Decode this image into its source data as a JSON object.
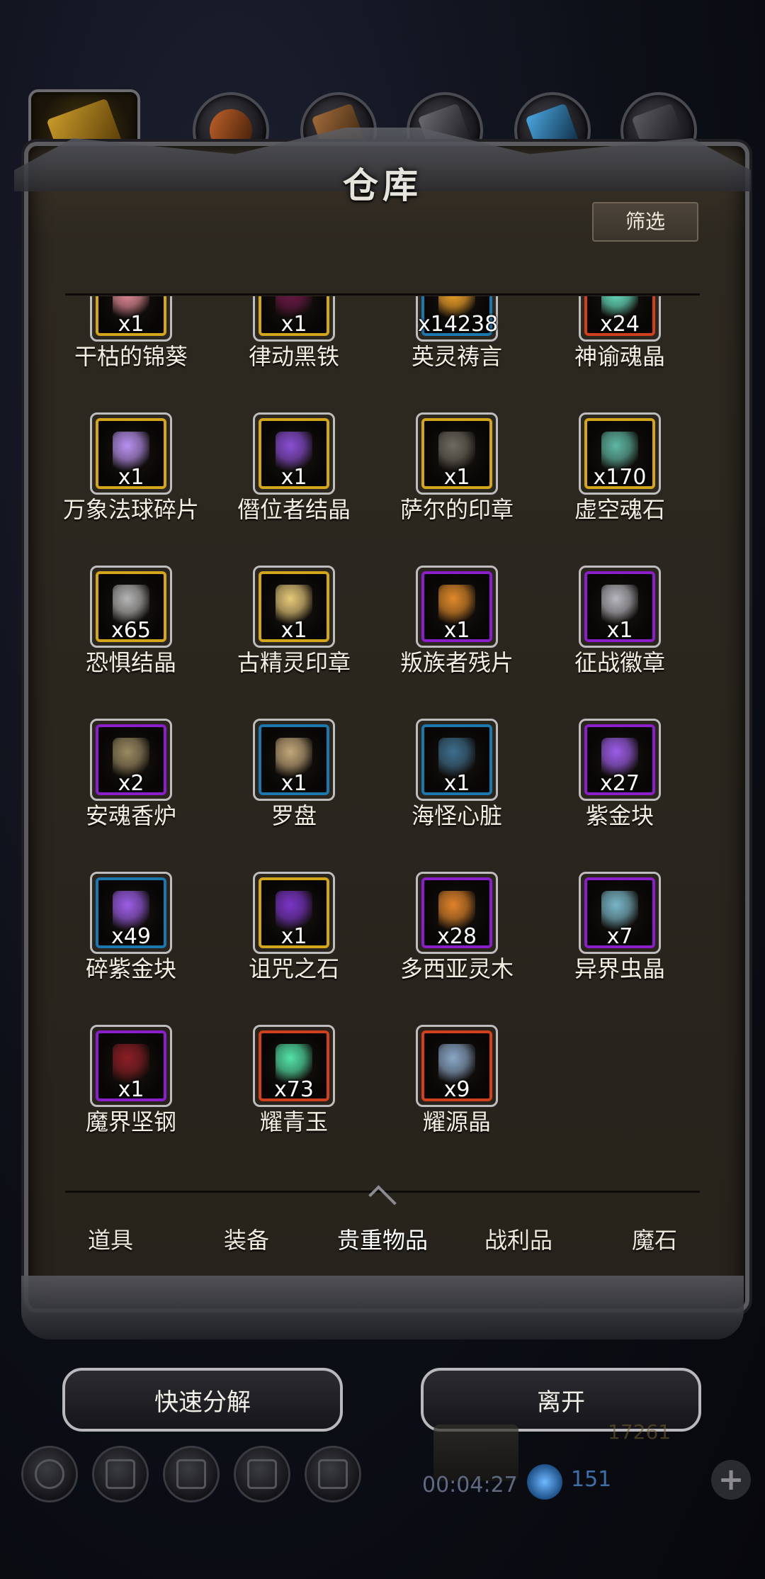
{
  "window": {
    "title": "仓库"
  },
  "filter_label": "筛选",
  "rarity_colors": {
    "legendary": "#d3a51a",
    "epic": "#8a1fc9",
    "rare": "#1b77ad",
    "mythic": "#d0401c"
  },
  "items": [
    {
      "name": "干枯的锦葵",
      "count": "x1",
      "rarity": "legendary",
      "icon": "dried-mallow-icon",
      "color": "#e58c9a"
    },
    {
      "name": "律动黑铁",
      "count": "x1",
      "rarity": "legendary",
      "icon": "pulse-black-iron-icon",
      "color": "#6a1846"
    },
    {
      "name": "英灵祷言",
      "count": "x14238",
      "rarity": "rare",
      "icon": "hero-prayer-icon",
      "color": "#f4a52a"
    },
    {
      "name": "神谕魂晶",
      "count": "x24",
      "rarity": "mythic",
      "icon": "oracle-soul-crystal-icon",
      "color": "#67e3c3"
    },
    {
      "name": "万象法球碎片",
      "count": "x1",
      "rarity": "legendary",
      "icon": "orb-shard-icon",
      "color": "#b991f1"
    },
    {
      "name": "僭位者结晶",
      "count": "x1",
      "rarity": "legendary",
      "icon": "usurper-crystal-icon",
      "color": "#8a4ed4"
    },
    {
      "name": "萨尔的印章",
      "count": "x1",
      "rarity": "legendary",
      "icon": "sal-seal-icon",
      "color": "#6d6a60"
    },
    {
      "name": "虚空魂石",
      "count": "x170",
      "rarity": "legendary",
      "icon": "void-soulstone-icon",
      "color": "#5fb7a4"
    },
    {
      "name": "恐惧结晶",
      "count": "x65",
      "rarity": "legendary",
      "icon": "fear-crystal-icon",
      "color": "#b5b5b5"
    },
    {
      "name": "古精灵印章",
      "count": "x1",
      "rarity": "legendary",
      "icon": "ancient-elf-seal-icon",
      "color": "#e6c97a"
    },
    {
      "name": "叛族者残片",
      "count": "x1",
      "rarity": "epic",
      "icon": "traitor-fragment-icon",
      "color": "#e08a2a"
    },
    {
      "name": "征战徽章",
      "count": "x1",
      "rarity": "epic",
      "icon": "campaign-badge-icon",
      "color": "#b7b7bf"
    },
    {
      "name": "安魂香炉",
      "count": "x2",
      "rarity": "epic",
      "icon": "soul-censer-icon",
      "color": "#9a8a62"
    },
    {
      "name": "罗盘",
      "count": "x1",
      "rarity": "rare",
      "icon": "compass-icon",
      "color": "#c2a77a"
    },
    {
      "name": "海怪心脏",
      "count": "x1",
      "rarity": "rare",
      "icon": "sea-monster-heart-icon",
      "color": "#3d6d8c"
    },
    {
      "name": "紫金块",
      "count": "x27",
      "rarity": "epic",
      "icon": "purple-gold-ingot-icon",
      "color": "#9c5de8"
    },
    {
      "name": "碎紫金块",
      "count": "x49",
      "rarity": "rare",
      "icon": "broken-purple-gold-icon",
      "color": "#9c5de8"
    },
    {
      "name": "诅咒之石",
      "count": "x1",
      "rarity": "legendary",
      "icon": "cursed-stone-icon",
      "color": "#7b35c8"
    },
    {
      "name": "多西亚灵木",
      "count": "x28",
      "rarity": "epic",
      "icon": "dosia-spirit-wood-icon",
      "color": "#e0842a"
    },
    {
      "name": "异界虫晶",
      "count": "x7",
      "rarity": "epic",
      "icon": "otherworld-insect-crystal-icon",
      "color": "#79b7c8"
    },
    {
      "name": "魔界坚钢",
      "count": "x1",
      "rarity": "epic",
      "icon": "demon-steel-icon",
      "color": "#8b1e25"
    },
    {
      "name": "耀青玉",
      "count": "x73",
      "rarity": "mythic",
      "icon": "radiant-jade-icon",
      "color": "#52e3a8"
    },
    {
      "name": "耀源晶",
      "count": "x9",
      "rarity": "mythic",
      "icon": "radiant-source-crystal-icon",
      "color": "#8aa7c8"
    }
  ],
  "bottom_tabs": [
    {
      "label": "道具",
      "active": false
    },
    {
      "label": "装备",
      "active": false
    },
    {
      "label": "贵重物品",
      "active": true
    },
    {
      "label": "战利品",
      "active": false
    },
    {
      "label": "魔石",
      "active": false
    }
  ],
  "actions": {
    "quick_decompose": "快速分解",
    "leave": "离开"
  },
  "hud": {
    "timer": "00:04:27",
    "gems": "151",
    "gold_partial": "17261"
  }
}
